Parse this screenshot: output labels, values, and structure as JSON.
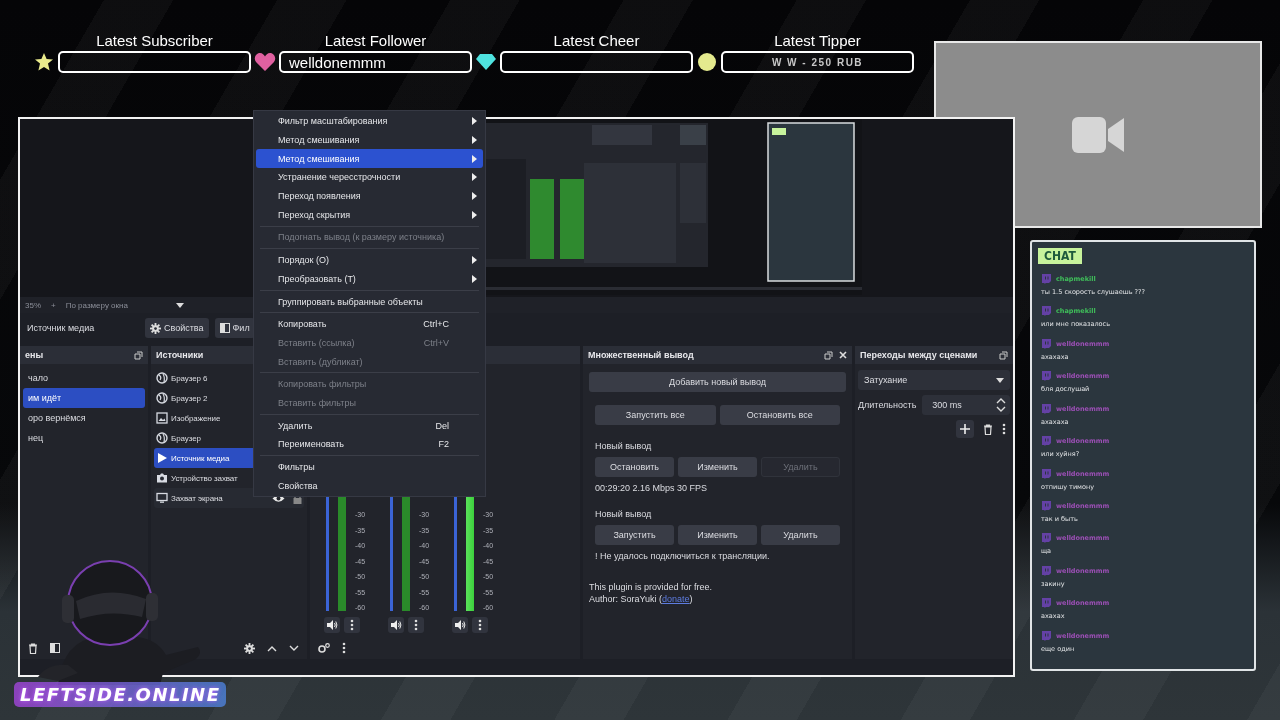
{
  "alerts": [
    {
      "label": "Latest Subscriber",
      "kind": "star"
    },
    {
      "label": "Latest Follower",
      "kind": "heart",
      "value": "welldonemmm"
    },
    {
      "label": "Latest Cheer",
      "kind": "gem"
    },
    {
      "label": "Latest Tipper",
      "kind": "coin",
      "value": "W W - 250 RUB"
    }
  ],
  "obs": {
    "zoom_bar": {
      "zoom": "35%",
      "plus": "+",
      "fit": "По размеру окна"
    },
    "source_toolbar": {
      "source": "Источник медиа",
      "buttons": [
        {
          "label": "Свойства",
          "kind": "gear"
        },
        {
          "label": "Фил",
          "kind": "filter"
        }
      ]
    },
    "scenes": {
      "title": "ены",
      "items": [
        {
          "label": "чало",
          "selected": false
        },
        {
          "label": "им идёт",
          "selected": true
        },
        {
          "label": "оро вернёмся",
          "selected": false
        },
        {
          "label": "нец",
          "selected": false
        }
      ]
    },
    "sources": {
      "title": "Источники",
      "items": [
        {
          "label": "Браузер 6",
          "kind": "browser",
          "selected": false,
          "hovered": false
        },
        {
          "label": "Браузер 2",
          "kind": "browser",
          "selected": false,
          "hovered": false
        },
        {
          "label": "Изображение",
          "kind": "image",
          "selected": false,
          "hovered": false
        },
        {
          "label": "Браузер",
          "kind": "browser",
          "selected": false,
          "hovered": false
        },
        {
          "label": "Источник медиа",
          "kind": "media",
          "selected": true,
          "hovered": false
        },
        {
          "label": "Устройство захват",
          "kind": "camera",
          "selected": false,
          "hovered": false
        },
        {
          "label": "Захват экрана",
          "kind": "display",
          "selected": false,
          "hovered": true
        }
      ]
    },
    "mixer": {
      "channels": [
        {
          "active": false,
          "ticks": [
            "-30",
            "-35",
            "-40",
            "-45",
            "-50",
            "-55",
            "-60"
          ]
        },
        {
          "active": false,
          "ticks": [
            "-30",
            "-35",
            "-40",
            "-45",
            "-50",
            "-55",
            "-60"
          ]
        },
        {
          "active": true,
          "ticks": [
            "-30",
            "-35",
            "-40",
            "-45",
            "-50",
            "-55",
            "-60"
          ]
        }
      ]
    },
    "multi_output": {
      "title": "Множественный вывод",
      "add": "Добавить новый вывод",
      "start_all": "Запустить все",
      "stop_all": "Остановить все",
      "outputs": [
        {
          "name": "Новый вывод",
          "buttons": [
            {
              "label": "Остановить",
              "disabled": false
            },
            {
              "label": "Изменить",
              "disabled": false
            },
            {
              "label": "Удалить",
              "disabled": true
            }
          ],
          "status": "00:29:20  2.16 Mbps  30 FPS"
        },
        {
          "name": "Новый вывод",
          "buttons": [
            {
              "label": "Запустить",
              "disabled": false
            },
            {
              "label": "Изменить",
              "disabled": false
            },
            {
              "label": "Удалить",
              "disabled": false
            }
          ],
          "status": "! Не удалось подключиться к трансляции."
        }
      ],
      "note": "This plugin is provided for free.",
      "author_prefix": "Author: SoraYuki (",
      "link": "donate",
      "author_suffix": ")"
    },
    "transitions": {
      "title": "Переходы между сценами",
      "transition": "Затухание",
      "duration_label": "Длительность",
      "duration": "300 ms"
    }
  },
  "context_menu": [
    {
      "kind": "item",
      "label": "Фильтр масштабирования",
      "submenu": true,
      "disabled": false,
      "selected": false
    },
    {
      "kind": "item",
      "label": "Метод смешивания",
      "submenu": true,
      "disabled": false,
      "selected": false
    },
    {
      "kind": "item",
      "label": "Метод смешивания",
      "submenu": true,
      "disabled": false,
      "selected": true
    },
    {
      "kind": "item",
      "label": "Устранение чересстрочности",
      "submenu": true,
      "disabled": false,
      "selected": false
    },
    {
      "kind": "item",
      "label": "Переход появления",
      "submenu": true,
      "disabled": false,
      "selected": false
    },
    {
      "kind": "item",
      "label": "Переход скрытия",
      "submenu": true,
      "disabled": false,
      "selected": false
    },
    {
      "kind": "separator"
    },
    {
      "kind": "item",
      "label": "Подогнать вывод (к размеру источника)",
      "submenu": false,
      "disabled": true,
      "selected": false
    },
    {
      "kind": "separator"
    },
    {
      "kind": "item",
      "label": "Порядок (O)",
      "submenu": true,
      "disabled": false,
      "selected": false
    },
    {
      "kind": "item",
      "label": "Преобразовать (T)",
      "submenu": true,
      "disabled": false,
      "selected": false
    },
    {
      "kind": "separator"
    },
    {
      "kind": "item",
      "label": "Группировать выбранные объекты",
      "submenu": false,
      "disabled": false,
      "selected": false
    },
    {
      "kind": "separator"
    },
    {
      "kind": "item",
      "label": "Копировать",
      "shortcut": "Ctrl+C",
      "submenu": false,
      "disabled": false,
      "selected": false
    },
    {
      "kind": "item",
      "label": "Вставить (ссылка)",
      "shortcut": "Ctrl+V",
      "submenu": false,
      "disabled": true,
      "selected": false
    },
    {
      "kind": "item",
      "label": "Вставить (дубликат)",
      "submenu": false,
      "disabled": true,
      "selected": false
    },
    {
      "kind": "separator"
    },
    {
      "kind": "item",
      "label": "Копировать фильтры",
      "submenu": false,
      "disabled": true,
      "selected": false
    },
    {
      "kind": "item",
      "label": "Вставить фильтры",
      "submenu": false,
      "disabled": true,
      "selected": false
    },
    {
      "kind": "separator"
    },
    {
      "kind": "item",
      "label": "Удалить",
      "shortcut": "Del",
      "submenu": false,
      "disabled": false,
      "selected": false
    },
    {
      "kind": "item",
      "label": "Переименовать",
      "shortcut": "F2",
      "submenu": false,
      "disabled": false,
      "selected": false
    },
    {
      "kind": "separator"
    },
    {
      "kind": "item",
      "label": "Фильтры",
      "submenu": false,
      "disabled": false,
      "selected": false
    },
    {
      "kind": "item",
      "label": "Свойства",
      "submenu": false,
      "disabled": false,
      "selected": false
    }
  ],
  "chat": {
    "title": "CHAT",
    "messages": [
      {
        "user": "chapmekill",
        "color": "#3fbf5a",
        "text": "ты 1.5 скорость слушаешь ???"
      },
      {
        "user": "chapmekill",
        "color": "#3fbf5a",
        "text": "или мне показалось"
      },
      {
        "user": "welldonemmm",
        "color": "#9b4fb5",
        "text": "ахахаха"
      },
      {
        "user": "welldonemmm",
        "color": "#9b4fb5",
        "text": "бля дослушай"
      },
      {
        "user": "welldonemmm",
        "color": "#9b4fb5",
        "text": "ахахаха"
      },
      {
        "user": "welldonemmm",
        "color": "#9b4fb5",
        "text": "или хуйня?"
      },
      {
        "user": "welldonemmm",
        "color": "#9b4fb5",
        "text": "отпишу тимону"
      },
      {
        "user": "welldonemmm",
        "color": "#9b4fb5",
        "text": "так и быть"
      },
      {
        "user": "welldonemmm",
        "color": "#9b4fb5",
        "text": "ща"
      },
      {
        "user": "welldonemmm",
        "color": "#9b4fb5",
        "text": "закину"
      },
      {
        "user": "welldonemmm",
        "color": "#9b4fb5",
        "text": "ахахах"
      },
      {
        "user": "welldonemmm",
        "color": "#9b4fb5",
        "text": "еще один"
      }
    ]
  },
  "logo": "LEFTSIDE.ONLINE"
}
